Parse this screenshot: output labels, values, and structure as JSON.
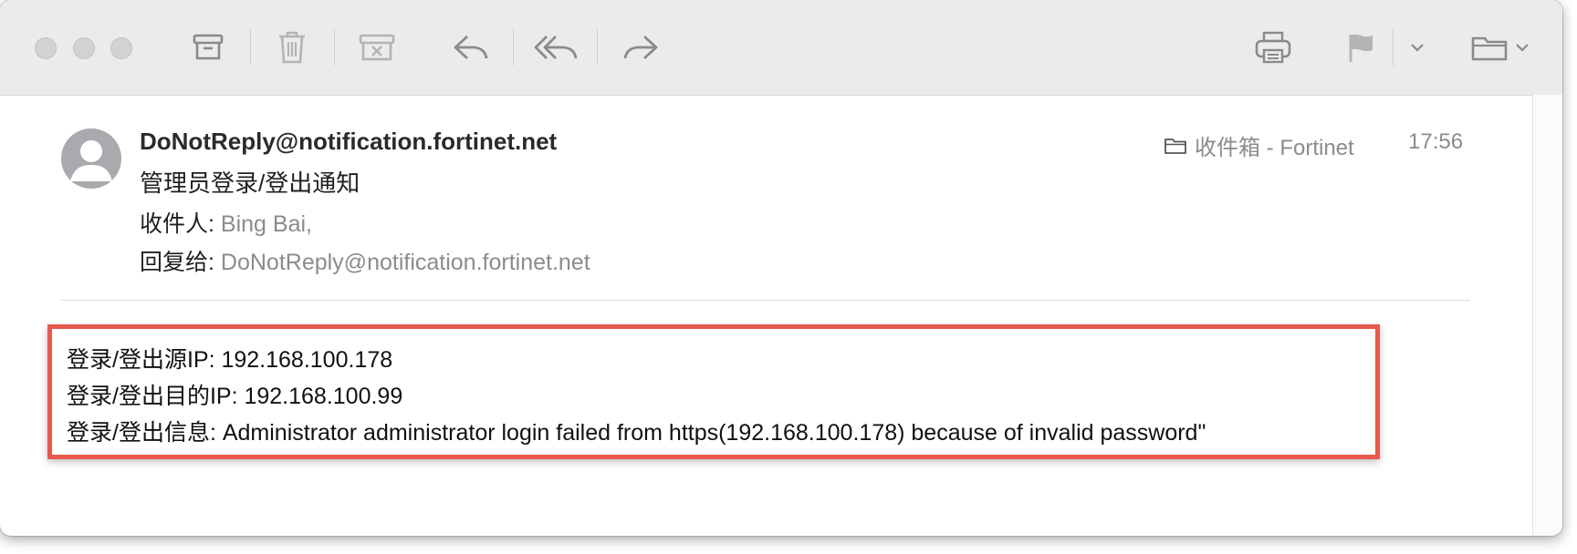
{
  "toolbar": {
    "buttons": [
      {
        "name": "archive",
        "icon": "archive-icon"
      },
      {
        "name": "delete",
        "icon": "trash-icon"
      },
      {
        "name": "junk",
        "icon": "junk-icon"
      },
      {
        "name": "reply",
        "icon": "reply-icon"
      },
      {
        "name": "reply-all",
        "icon": "reply-all-icon"
      },
      {
        "name": "forward",
        "icon": "forward-icon"
      },
      {
        "name": "print",
        "icon": "printer-icon"
      },
      {
        "name": "flag",
        "icon": "flag-icon"
      },
      {
        "name": "move",
        "icon": "folder-icon"
      }
    ]
  },
  "message": {
    "sender": "DoNotReply@notification.fortinet.net",
    "subject": "管理员登录/登出通知",
    "to_label": "收件人:",
    "to_value": "Bing Bai,",
    "reply_to_label": "回复给:",
    "reply_to_value": "DoNotReply@notification.fortinet.net",
    "mailbox": "收件箱 - Fortinet",
    "time": "17:56"
  },
  "body": {
    "lines": [
      "登录/登出源IP: 192.168.100.178",
      "登录/登出目的IP: 192.168.100.99",
      "登录/登出信息: Administrator administrator login failed from https(192.168.100.178) because of invalid password\""
    ],
    "highlight_color": "#e8584c"
  }
}
